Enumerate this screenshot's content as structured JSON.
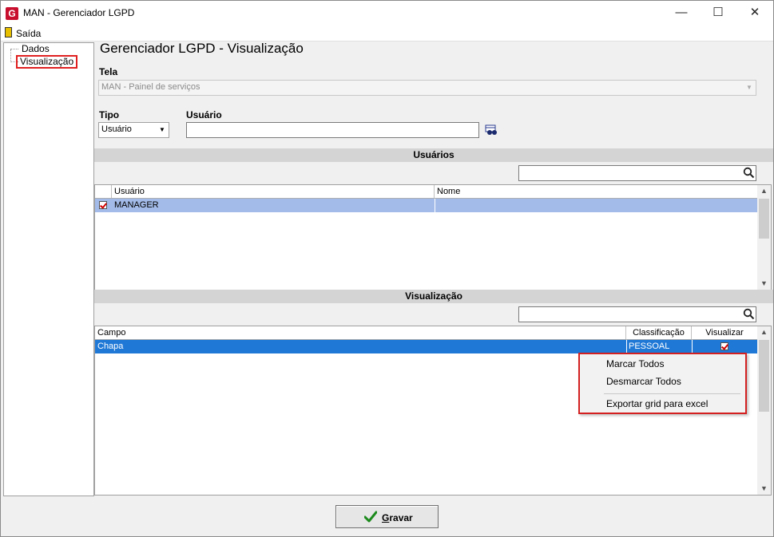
{
  "window": {
    "title": "MAN - Gerenciador LGPD",
    "app_icon_letter": "G",
    "minimize": "—",
    "maximize": "☐",
    "close": "✕"
  },
  "menu": {
    "exit_label": "Saída"
  },
  "tree": {
    "items": [
      {
        "label": "Dados"
      },
      {
        "label": "Visualização"
      }
    ]
  },
  "page": {
    "heading": "Gerenciador LGPD - Visualização"
  },
  "form": {
    "tela_label": "Tela",
    "tela_value": "MAN - Painel de serviços",
    "tipo_label": "Tipo",
    "tipo_value": "Usuário",
    "usuario_label": "Usuário",
    "usuario_value": ""
  },
  "users_section": {
    "title": "Usuários",
    "search_value": "",
    "columns": [
      "Usuário",
      "Nome"
    ],
    "rows": [
      {
        "checked": true,
        "usuario": "MANAGER",
        "nome": ""
      }
    ]
  },
  "view_section": {
    "title": "Visualização",
    "search_value": "",
    "columns": [
      "Campo",
      "Classificação",
      "Visualizar"
    ],
    "rows": [
      {
        "campo": "Chapa",
        "classificacao": "PESSOAL",
        "visualizar": true
      }
    ]
  },
  "context_menu": {
    "items": [
      "Marcar Todos",
      "Desmarcar Todos",
      "Exportar grid para excel"
    ]
  },
  "footer": {
    "save_label": "Gravar"
  },
  "colors": {
    "user_row_selected": "#a3bbe8",
    "view_row_selected": "#1f78d6",
    "highlight_border": "#d42020",
    "section_bar": "#d4d4d4"
  }
}
